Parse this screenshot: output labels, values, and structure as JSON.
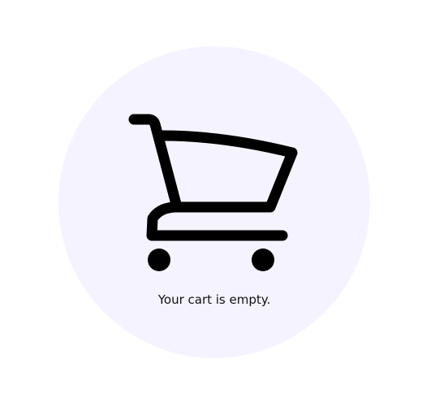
{
  "cart": {
    "icon": "shopping-cart-icon",
    "empty_message": "Your cart is empty."
  },
  "colors": {
    "circle_background": "#f5f3ff",
    "icon": "#000000",
    "text": "#111111"
  }
}
